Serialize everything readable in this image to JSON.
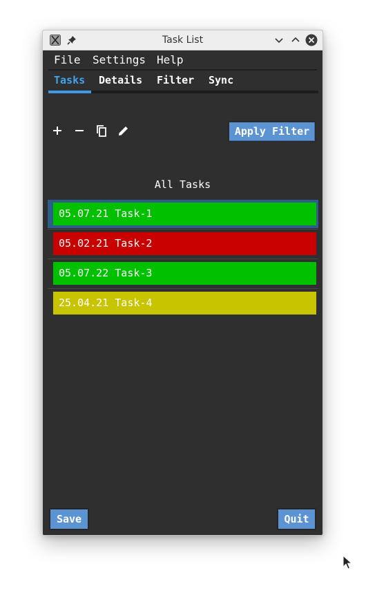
{
  "window": {
    "title": "Task List",
    "titlebar_icons": [
      "app-x-icon",
      "pin-icon",
      "minimize-icon",
      "maximize-icon",
      "close-icon"
    ]
  },
  "menu": {
    "file": "File",
    "settings": "Settings",
    "help": "Help"
  },
  "tabs": [
    {
      "label": "Tasks",
      "active": true
    },
    {
      "label": "Details",
      "active": false
    },
    {
      "label": "Filter",
      "active": false
    },
    {
      "label": "Sync",
      "active": false
    }
  ],
  "toolbar": {
    "icons": [
      "add-icon",
      "remove-icon",
      "copy-icon",
      "edit-icon"
    ],
    "apply_filter_label": "Apply Filter"
  },
  "list": {
    "title": "All Tasks",
    "items": [
      {
        "label": "05.07.21 Task-1",
        "color": "#00c000",
        "selected": true
      },
      {
        "label": "05.02.21 Task-2",
        "color": "#c80000",
        "selected": false
      },
      {
        "label": "05.07.22 Task-3",
        "color": "#00c000",
        "selected": false
      },
      {
        "label": "25.04.21 Task-4",
        "color": "#c8c400",
        "selected": false
      }
    ]
  },
  "buttons": {
    "save_label": "Save",
    "quit_label": "Quit"
  },
  "colors": {
    "window_bg": "#2f2f2f",
    "accent": "#3fa4ec",
    "button_bg": "#5c93d3",
    "selection": "#2d5d8a"
  }
}
